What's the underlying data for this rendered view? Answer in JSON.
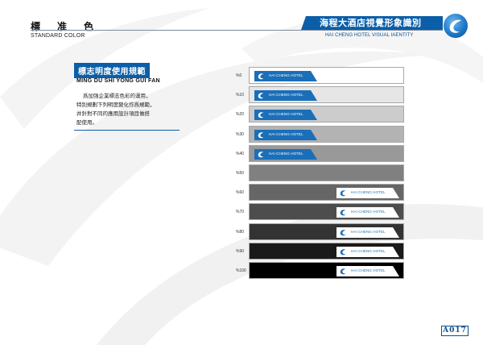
{
  "header": {
    "title_cn": "標准色",
    "title_en": "STANDARD COLOR",
    "brand_cn": "海程大酒店視覺形象識別",
    "brand_en": "HAI CHENG HOTEL VISUAL IAENTITY"
  },
  "section": {
    "title_cn": "標志明度使用規範",
    "title_en": "MING DU SHI YONG GUI FAN",
    "body": "爲加强企業標志色彩的運用，\n特別規劃下列明度變化作爲規範，\n并針對不同的應用設計項目做搭\n配使用。"
  },
  "swatches": [
    {
      "label": "%0",
      "gray": "#ffffff",
      "plate": "#1a6fb8",
      "plate_text": "#ffffff",
      "logo_on_right": false
    },
    {
      "label": "%10",
      "gray": "#e6e6e6",
      "plate": "#1a6fb8",
      "plate_text": "#ffffff",
      "logo_on_right": false
    },
    {
      "label": "%20",
      "gray": "#cccccc",
      "plate": "#1a6fb8",
      "plate_text": "#ffffff",
      "logo_on_right": false
    },
    {
      "label": "%30",
      "gray": "#b3b3b3",
      "plate": "#1a6fb8",
      "plate_text": "#ffffff",
      "logo_on_right": false
    },
    {
      "label": "%40",
      "gray": "#999999",
      "plate": "#1a6fb8",
      "plate_text": "#ffffff",
      "logo_on_right": false
    },
    {
      "label": "%50",
      "gray": "#808080",
      "plate": null,
      "plate_text": null,
      "logo_on_right": false
    },
    {
      "label": "%60",
      "gray": "#666666",
      "plate": "#ffffff",
      "plate_text": "#1a6fb8",
      "logo_on_right": true
    },
    {
      "label": "%70",
      "gray": "#4d4d4d",
      "plate": "#ffffff",
      "plate_text": "#1a6fb8",
      "logo_on_right": true
    },
    {
      "label": "%80",
      "gray": "#333333",
      "plate": "#ffffff",
      "plate_text": "#1a6fb8",
      "logo_on_right": true
    },
    {
      "label": "%90",
      "gray": "#1a1a1a",
      "plate": "#ffffff",
      "plate_text": "#1a6fb8",
      "logo_on_right": true
    },
    {
      "label": "%100",
      "gray": "#000000",
      "plate": "#ffffff",
      "plate_text": "#1a6fb8",
      "logo_on_right": true
    }
  ],
  "logo_text": "HAI CHENG HOTEL",
  "page_number": "A017",
  "colors": {
    "brand_blue": "#0b5ea8",
    "brand_navy": "#0b4f8f"
  }
}
